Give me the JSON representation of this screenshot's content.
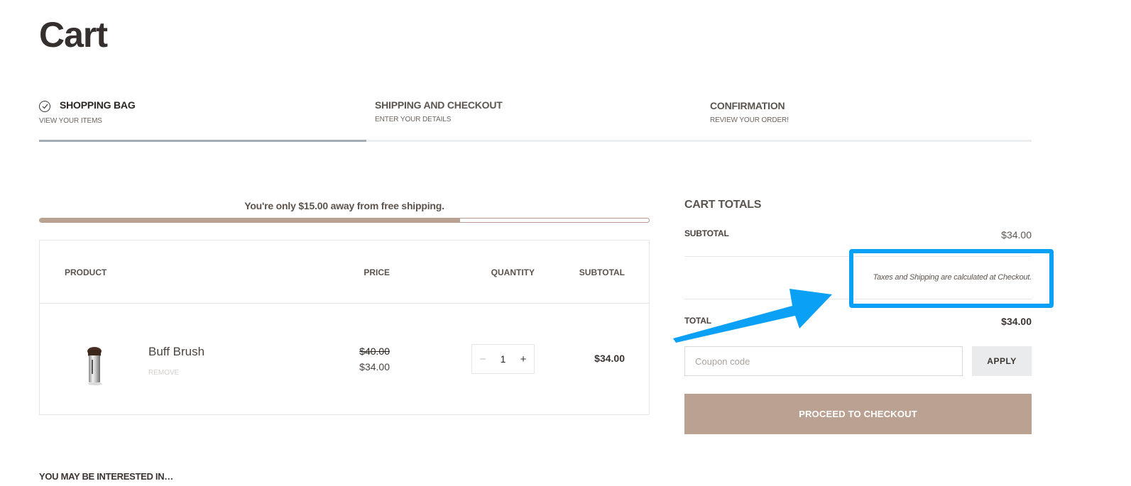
{
  "page": {
    "title": "Cart"
  },
  "steps": [
    {
      "title": "SHOPPING BAG",
      "subtitle": "VIEW YOUR ITEMS",
      "completed": true
    },
    {
      "title": "SHIPPING AND CHECKOUT",
      "subtitle": "ENTER YOUR DETAILS",
      "completed": false
    },
    {
      "title": "CONFIRMATION",
      "subtitle": "REVIEW YOUR ORDER!",
      "completed": false
    }
  ],
  "steps_progress": 0.33,
  "free_shipping": {
    "message": "You're only $15.00 away from free shipping.",
    "progress": 0.69
  },
  "cart_table": {
    "headers": {
      "product": "PRODUCT",
      "price": "PRICE",
      "quantity": "QUANTITY",
      "subtotal": "SUBTOTAL"
    },
    "items": [
      {
        "name": "Buff Brush",
        "remove_label": "REMOVE",
        "old_price": "$40.00",
        "price": "$34.00",
        "quantity": "1",
        "minus": "−",
        "plus": "+",
        "subtotal": "$34.00",
        "thumbnail_icon": "brush-thumbnail"
      }
    ]
  },
  "interested": {
    "title": "YOU MAY BE INTERESTED IN…"
  },
  "totals": {
    "title": "CART TOTALS",
    "subtotal_label": "SUBTOTAL",
    "subtotal_value": "$34.00",
    "tax_note": "Taxes and Shipping are calculated at Checkout.",
    "total_label": "TOTAL",
    "total_value": "$34.00"
  },
  "coupon": {
    "placeholder": "Coupon code",
    "value": "",
    "apply_label": "APPLY"
  },
  "checkout": {
    "label": "PROCEED TO CHECKOUT"
  },
  "annotation": {
    "color": "#0aa0f5"
  },
  "colors": {
    "accent": "#bba192",
    "progress_fill": "#b8a393",
    "steps_fill": "#a2acb3"
  }
}
